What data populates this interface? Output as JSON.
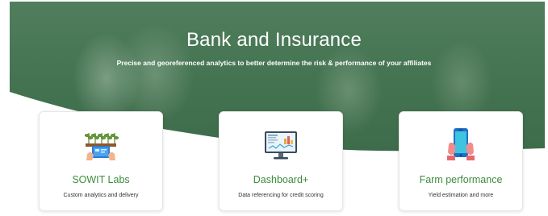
{
  "hero": {
    "title": "Bank and Insurance",
    "subtitle": "Precise and georeferenced analytics to better determine the risk & performance of your affiliates"
  },
  "cards": [
    {
      "title": "SOWIT Labs",
      "description": "Custom analytics and delivery",
      "icon": "lab-plants-icon"
    },
    {
      "title": "Dashboard+",
      "description": "Data referencing for credit scoring",
      "icon": "dashboard-monitor-icon"
    },
    {
      "title": "Farm performance",
      "description": "Yield estimation and more",
      "icon": "smartphone-hand-icon"
    }
  ],
  "colors": {
    "accent": "#3e8c3e",
    "hero_green": "#4d7a5a"
  }
}
